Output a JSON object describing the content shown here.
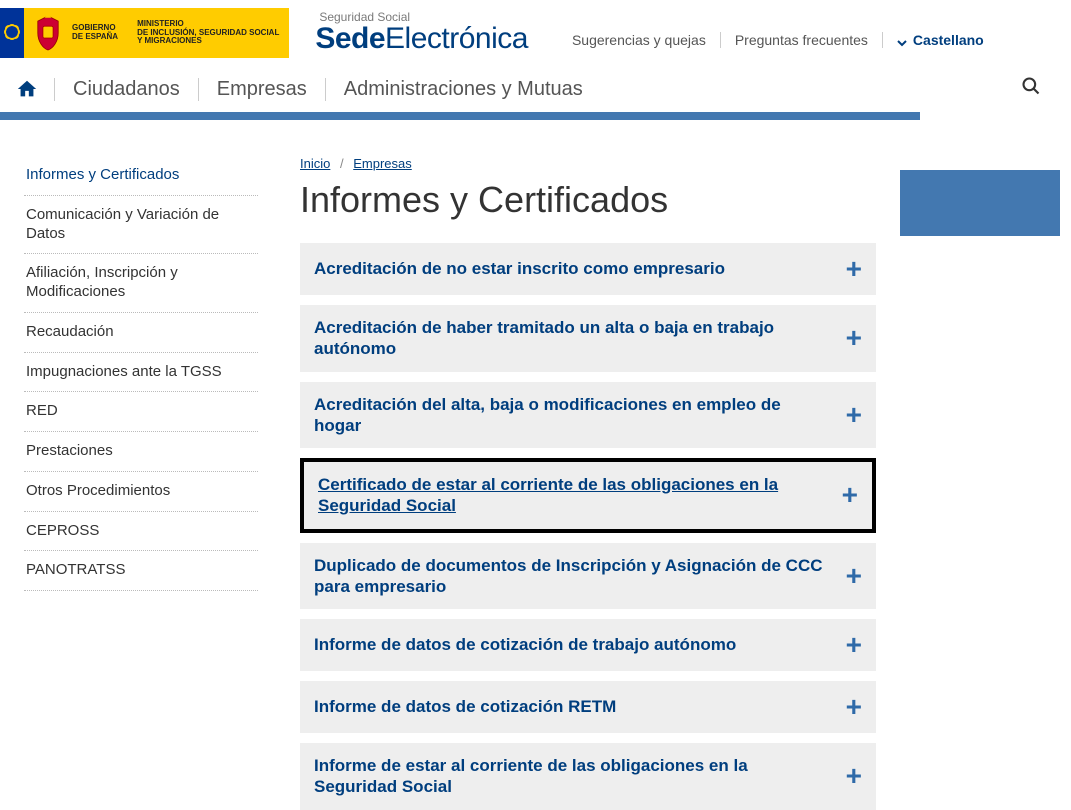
{
  "header": {
    "gov1_line1": "GOBIERNO",
    "gov1_line2": "DE ESPAÑA",
    "gov2_line1": "MINISTERIO",
    "gov2_line2": "DE INCLUSIÓN, SEGURIDAD SOCIAL",
    "gov2_line3": "Y MIGRACIONES",
    "brand_sub": "Seguridad Social",
    "brand_bold": "Sede",
    "brand_light": "Electrónica",
    "top_links": [
      "Sugerencias y quejas",
      "Preguntas frecuentes"
    ],
    "lang": "Castellano"
  },
  "nav": {
    "items": [
      "Ciudadanos",
      "Empresas",
      "Administraciones y Mutuas"
    ]
  },
  "breadcrumb": {
    "home": "Inicio",
    "section": "Empresas"
  },
  "page_title": "Informes y Certificados",
  "sidebar": {
    "items": [
      "Informes y Certificados",
      "Comunicación y Variación de Datos",
      "Afiliación, Inscripción y Modificaciones",
      "Recaudación",
      "Impugnaciones ante la TGSS",
      "RED",
      "Prestaciones",
      "Otros Procedimientos",
      "CEPROSS",
      "PANOTRATSS"
    ]
  },
  "accordion": {
    "items": [
      {
        "title": "Acreditación de no estar inscrito como empresario"
      },
      {
        "title": "Acreditación de haber tramitado un alta o baja en trabajo autónomo"
      },
      {
        "title": "Acreditación del alta, baja o modificaciones en empleo de hogar"
      },
      {
        "title": "Certificado de estar al corriente de las obligaciones en la Seguridad Social",
        "highlight": true
      },
      {
        "title": "Duplicado de documentos de Inscripción y Asignación de CCC para empresario"
      },
      {
        "title": "Informe de datos de cotización de trabajo autónomo"
      },
      {
        "title": "Informe de datos de cotización RETM"
      },
      {
        "title": "Informe de estar al corriente de las obligaciones en la Seguridad Social"
      }
    ]
  }
}
